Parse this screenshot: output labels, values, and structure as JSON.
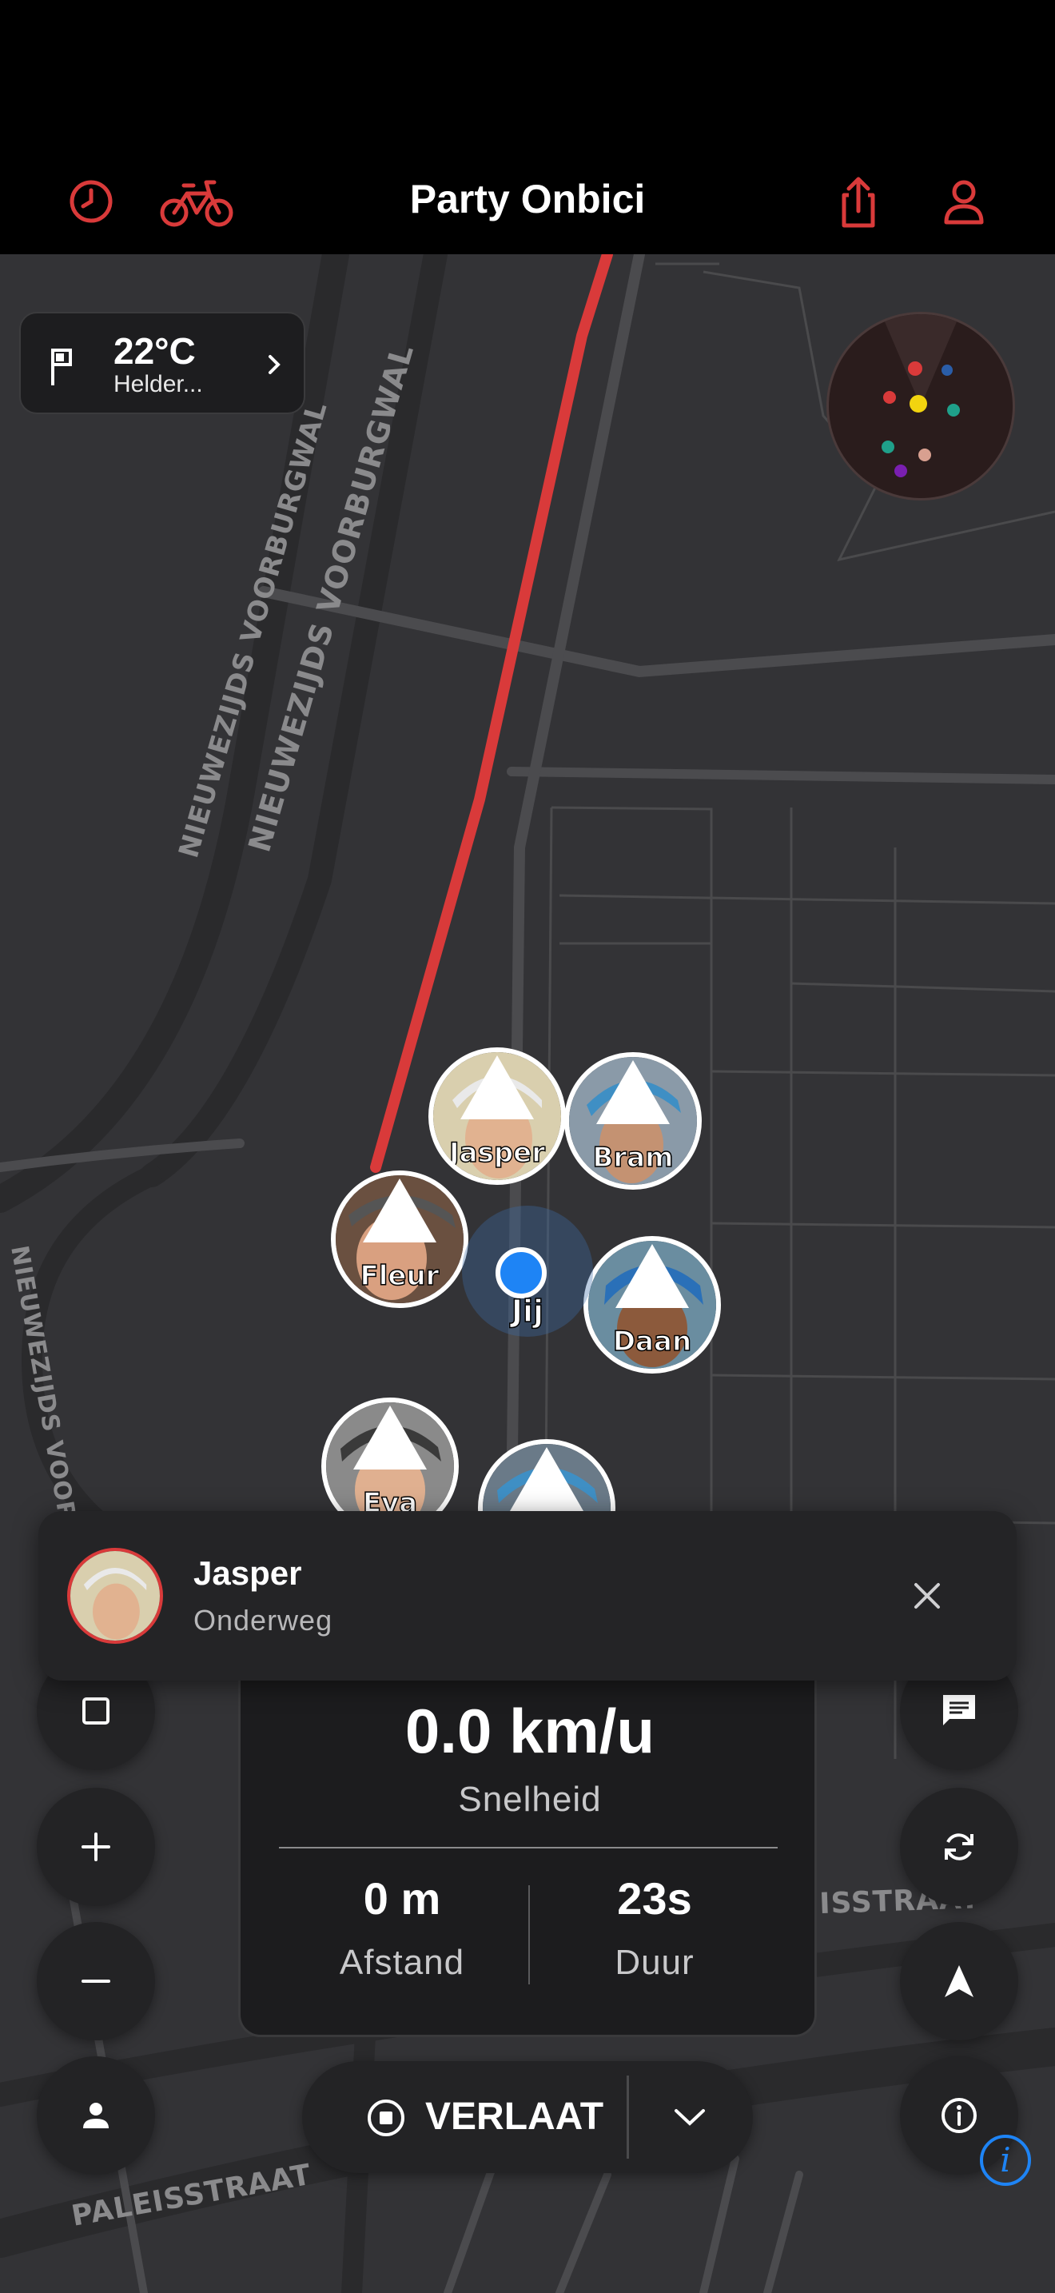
{
  "header": {
    "title": "Party Onbici",
    "icons": [
      "history-icon",
      "bike-icon",
      "share-icon",
      "profile-icon"
    ],
    "accent_color": "#d93a3a"
  },
  "weather": {
    "temperature": "22°C",
    "condition": "Helder..."
  },
  "map": {
    "street_labels": [
      "NIEUWEZIJDS VOORBURGWAL",
      "NIEUWEZIJDS VOORBURGWAL",
      "NIEUWEZIJDS VOORBURGWAL",
      "PALEISSTRAAT",
      "EISSTRAAT"
    ],
    "route_color": "#d93a3a"
  },
  "riders": [
    {
      "name": "Jasper"
    },
    {
      "name": "Bram"
    },
    {
      "name": "Fleur"
    },
    {
      "name": "Daan"
    },
    {
      "name": "Eva"
    },
    {
      "name": ""
    }
  ],
  "self": {
    "label": "Jij",
    "color": "#1e84f5"
  },
  "popup": {
    "name": "Jasper",
    "status": "Onderweg"
  },
  "stats": {
    "speed": "0.0 km/u",
    "speed_label": "Snelheid",
    "distance": "0 m",
    "distance_label": "Afstand",
    "duration": "23s",
    "duration_label": "Duur"
  },
  "controls": {
    "leave_label": "VERLAAT",
    "left_buttons": [
      "square-icon",
      "plus-icon",
      "minus-icon",
      "person-icon"
    ],
    "right_buttons": [
      "chat-icon",
      "rotate-icon",
      "navigate-icon",
      "info-icon"
    ]
  }
}
